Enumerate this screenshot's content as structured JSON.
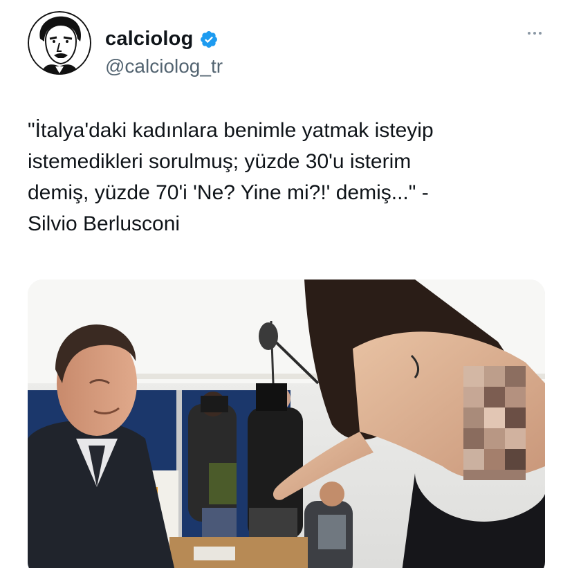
{
  "author": {
    "display_name": "calciolog",
    "handle": "@calciolog_tr",
    "verified": true,
    "avatar_icon": "caricature-avatar-icon"
  },
  "tweet": {
    "text": "\"İtalya'daki kadınlara benimle yatmak isteyip\nistemedikleri sorulmuş; yüzde 30'u isterim\ndemiş, yüzde 70'i 'Ne? Yine mi?!' demiş...\" -\nSilvio Berlusconi"
  },
  "colors": {
    "text": "#0f1419",
    "secondary": "#536471",
    "verified_badge": "#1d9bf0"
  },
  "icons": {
    "more": "more-dots-icon",
    "verified": "verified-badge-icon"
  }
}
